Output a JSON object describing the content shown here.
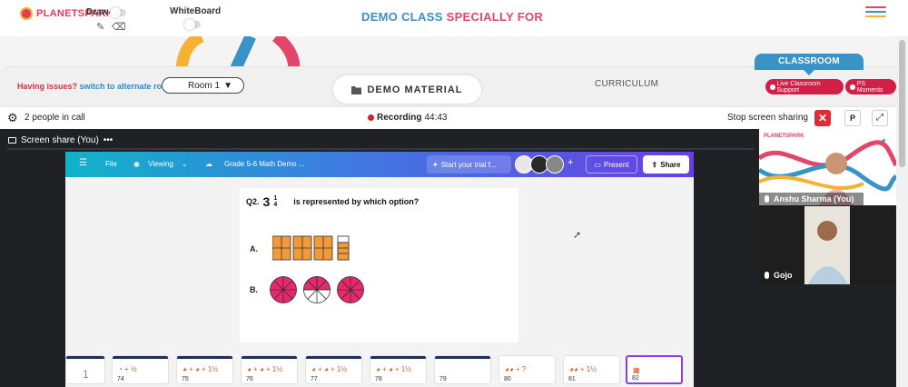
{
  "header": {
    "logo_text": "PLANETSPARK",
    "draw_label": "Draw",
    "whiteboard_label": "WhiteBoard",
    "title_part1": "DEMO CLASS",
    "title_part2": "SPECIALLY FOR",
    "menu_colors": [
      "#e2476a",
      "#3a93c7",
      "#f6b132"
    ]
  },
  "room_bar": {
    "having_issues": "Having issues?",
    "alternate_room": "switch to alternate room",
    "room_selected": "Room 1",
    "demo_material": "DEMO MATERIAL",
    "curriculum": "CURRICULUM",
    "classroom_tab": "CLASSROOM",
    "live_support": "Live Classroom Support",
    "ps_moments": "PS Moments"
  },
  "call_bar": {
    "people": "2 people in call",
    "recording_label": "Recording",
    "recording_time": "44:43",
    "stop_sharing": "Stop screen sharing",
    "p_button": "P"
  },
  "stage": {
    "share_label": "Screen share (You)",
    "more": "•••"
  },
  "canva": {
    "file": "File",
    "viewing": "Viewing",
    "doc_title": "Grade 5-6 Math Demo ...",
    "trial": "Start your trial f...",
    "plus": "+",
    "present": "Present",
    "share": "Share"
  },
  "slide": {
    "qnum": "Q2.",
    "whole": "3",
    "num": "1",
    "den": "4",
    "question": "is represented by which option?",
    "option_a": "A.",
    "option_b": "B."
  },
  "thumbnails": [
    {
      "count": "",
      "glyph": "1"
    },
    {
      "count": "74",
      "glyph": "◔ + ½"
    },
    {
      "count": "75",
      "glyph": "◕ + ◕ + 1½"
    },
    {
      "count": "76",
      "glyph": "◕ + ◕ + 1½"
    },
    {
      "count": "",
      "glyph": "◕ + ◕ + 1½"
    },
    {
      "count": "77",
      "glyph": "◕ + ◕ + 1½"
    },
    {
      "count": "78",
      "glyph": "◕ + ◕ + 1½"
    },
    {
      "count": "79",
      "glyph": ""
    },
    {
      "count": "80",
      "glyph": "◕◕ + ?"
    },
    {
      "count": "81",
      "glyph": "◕◕ + 1½"
    },
    {
      "count": "82",
      "glyph": "▦"
    }
  ],
  "participants": [
    {
      "name": "Anshu Sharma (You)",
      "logo": "PLANETSPARK"
    },
    {
      "name": "Gojo"
    }
  ],
  "colors": {
    "brand_red": "#e2476a",
    "brand_blue": "#3a93c7",
    "support_pill": "#d11f45",
    "stage_bg": "#202124",
    "canva_purple": "#8b3fe0"
  }
}
